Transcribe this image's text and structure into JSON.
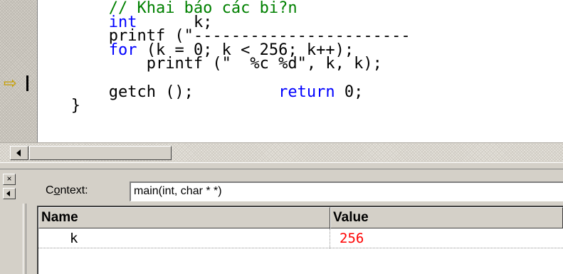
{
  "editor": {
    "lines": [
      {
        "indent": "       ",
        "parts": [
          {
            "cls": "cm",
            "text": "// Khai báo các bi?n"
          }
        ]
      },
      {
        "indent": "       ",
        "parts": [
          {
            "cls": "kw",
            "text": "int"
          },
          {
            "cls": "",
            "text": "      k;"
          }
        ]
      },
      {
        "indent": "       ",
        "parts": [
          {
            "cls": "",
            "text": "printf (\"-----------------------"
          }
        ]
      },
      {
        "indent": "       ",
        "parts": [
          {
            "cls": "kw",
            "text": "for"
          },
          {
            "cls": "",
            "text": " (k = 0; k < 256; k++);"
          }
        ]
      },
      {
        "indent": "           ",
        "parts": [
          {
            "cls": "",
            "text": "printf (\"  %c %d\", k, k);"
          }
        ]
      },
      {
        "indent": "",
        "parts": []
      },
      {
        "indent": "       ",
        "parts": [
          {
            "cls": "",
            "text": "getch ();         "
          },
          {
            "cls": "kw",
            "text": "return"
          },
          {
            "cls": "",
            "text": " 0;"
          }
        ]
      },
      {
        "indent": "   ",
        "parts": [
          {
            "cls": "",
            "text": "}"
          }
        ]
      }
    ],
    "current_line_marker": "⇨"
  },
  "variables": {
    "context_label": "Context:",
    "context_value": "main(int, char * *)",
    "close_glyph": "×",
    "columns": {
      "name": "Name",
      "value": "Value"
    },
    "rows": [
      {
        "name": "k",
        "value": "256"
      }
    ]
  },
  "colors": {
    "keyword": "#0000ff",
    "comment": "#008000",
    "changed_value": "#ff0000",
    "marker": "#c8a000"
  }
}
